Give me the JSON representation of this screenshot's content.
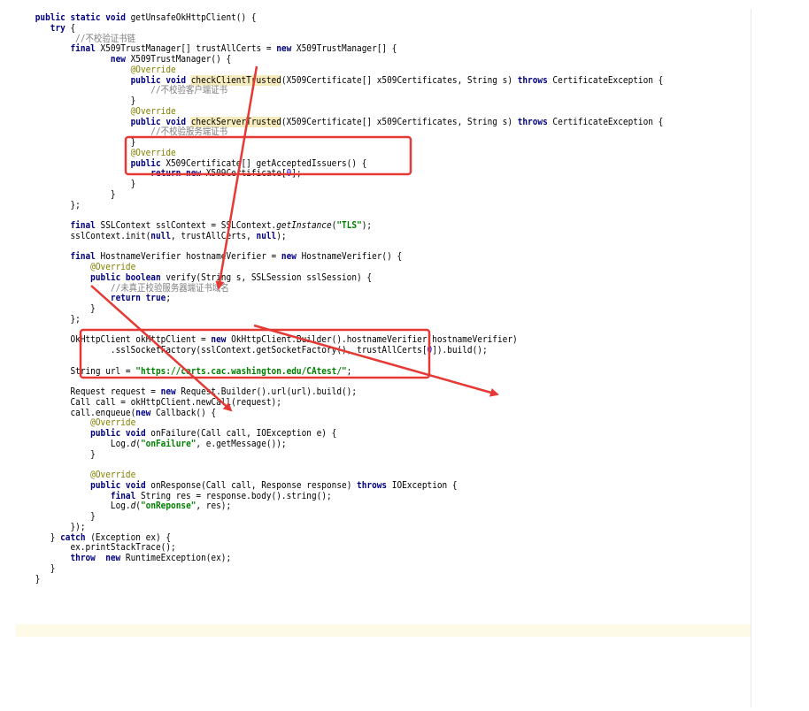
{
  "colors": {
    "keyword": "#000080",
    "annotation": "#808000",
    "comment": "#808080",
    "string": "#008000",
    "number": "#0000ff",
    "usage_highlight": "#f6ebbc",
    "current_line": "#fefae8",
    "markup_red": "#e53935"
  },
  "code_lines": [
    {
      "indent": 1,
      "tokens": [
        {
          "t": "public static void ",
          "c": "kw"
        },
        {
          "t": "getUnsafeOkHttpClient() {"
        }
      ]
    },
    {
      "indent": 4,
      "tokens": [
        {
          "t": "try ",
          "c": "kw"
        },
        {
          "t": "{"
        }
      ]
    },
    {
      "indent": 9,
      "tokens": [
        {
          "t": "//不校验证书链",
          "c": "com"
        }
      ]
    },
    {
      "indent": 8,
      "tokens": [
        {
          "t": "final ",
          "c": "kw"
        },
        {
          "t": "X509TrustManager[] trustAllCerts = "
        },
        {
          "t": "new ",
          "c": "kw"
        },
        {
          "t": "X509TrustManager[] {"
        }
      ]
    },
    {
      "indent": 16,
      "tokens": [
        {
          "t": "new ",
          "c": "kw"
        },
        {
          "t": "X509TrustManager() {"
        }
      ]
    },
    {
      "indent": 20,
      "tokens": [
        {
          "t": "@Override",
          "c": "ann"
        }
      ]
    },
    {
      "indent": 20,
      "tokens": [
        {
          "t": "public void ",
          "c": "kw"
        },
        {
          "t": "checkClientTrusted",
          "c": "usage"
        },
        {
          "t": "(X509Certificate[] x509Certificates, String s) "
        },
        {
          "t": "throws ",
          "c": "kw"
        },
        {
          "t": "CertificateException {"
        }
      ]
    },
    {
      "indent": 24,
      "tokens": [
        {
          "t": "//不校验客户端证书",
          "c": "com"
        }
      ]
    },
    {
      "indent": 20,
      "tokens": [
        {
          "t": "}"
        }
      ]
    },
    {
      "indent": 20,
      "tokens": [
        {
          "t": "@Override",
          "c": "ann"
        }
      ]
    },
    {
      "indent": 20,
      "tokens": [
        {
          "t": "public void ",
          "c": "kw"
        },
        {
          "t": "checkServerTrusted",
          "c": "usage"
        },
        {
          "t": "(X509Certificate[] x509Certificates, String s) "
        },
        {
          "t": "throws ",
          "c": "kw"
        },
        {
          "t": "CertificateException {"
        }
      ]
    },
    {
      "indent": 24,
      "tokens": [
        {
          "t": "//不校验服务端证书",
          "c": "com"
        }
      ]
    },
    {
      "indent": 20,
      "tokens": [
        {
          "t": "}"
        }
      ]
    },
    {
      "indent": 20,
      "tokens": [
        {
          "t": "@Override",
          "c": "ann"
        }
      ]
    },
    {
      "indent": 20,
      "tokens": [
        {
          "t": "public ",
          "c": "kw"
        },
        {
          "t": "X509Certificate[] getAcceptedIssuers() {"
        }
      ]
    },
    {
      "indent": 24,
      "tokens": [
        {
          "t": "return new ",
          "c": "kw"
        },
        {
          "t": "X509Certificate["
        },
        {
          "t": "0",
          "c": "num"
        },
        {
          "t": "];"
        }
      ]
    },
    {
      "indent": 20,
      "tokens": [
        {
          "t": "}"
        }
      ]
    },
    {
      "indent": 16,
      "tokens": [
        {
          "t": "}"
        }
      ]
    },
    {
      "indent": 8,
      "tokens": [
        {
          "t": "};"
        }
      ]
    },
    {
      "indent": 0,
      "tokens": []
    },
    {
      "indent": 8,
      "tokens": [
        {
          "t": "final ",
          "c": "kw"
        },
        {
          "t": "SSLContext sslContext = SSLContext."
        },
        {
          "t": "getInstance",
          "c": "ital"
        },
        {
          "t": "("
        },
        {
          "t": "\"TLS\"",
          "c": "str"
        },
        {
          "t": ");"
        }
      ]
    },
    {
      "indent": 8,
      "tokens": [
        {
          "t": "sslContext.init("
        },
        {
          "t": "null",
          "c": "kw"
        },
        {
          "t": ", trustAllCerts, "
        },
        {
          "t": "null",
          "c": "kw"
        },
        {
          "t": ");"
        }
      ]
    },
    {
      "indent": 0,
      "tokens": []
    },
    {
      "indent": 8,
      "tokens": [
        {
          "t": "final ",
          "c": "kw"
        },
        {
          "t": "HostnameVerifier hostnameVerifier = "
        },
        {
          "t": "new ",
          "c": "kw"
        },
        {
          "t": "HostnameVerifier() {"
        }
      ]
    },
    {
      "indent": 12,
      "tokens": [
        {
          "t": "@Override",
          "c": "ann"
        }
      ]
    },
    {
      "indent": 12,
      "tokens": [
        {
          "t": "public boolean ",
          "c": "kw"
        },
        {
          "t": "verify(String s, SSLSession sslSession) {"
        }
      ]
    },
    {
      "indent": 16,
      "tokens": [
        {
          "t": "//未真正校验服务器端证书域名",
          "c": "com"
        }
      ]
    },
    {
      "indent": 16,
      "tokens": [
        {
          "t": "return true",
          "c": "kw"
        },
        {
          "t": ";"
        }
      ]
    },
    {
      "indent": 12,
      "tokens": [
        {
          "t": "}"
        }
      ]
    },
    {
      "indent": 8,
      "tokens": [
        {
          "t": "};"
        }
      ]
    },
    {
      "indent": 0,
      "tokens": []
    },
    {
      "indent": 8,
      "tokens": [
        {
          "t": "OkHttpClient okHttpClient = "
        },
        {
          "t": "new ",
          "c": "kw"
        },
        {
          "t": "OkHttpClient.Builder().hostnameVerifier(hostnameVerifier)"
        }
      ]
    },
    {
      "indent": 16,
      "tokens": [
        {
          "t": ".sslSocketFactory(sslContext.getSocketFactory(), trustAllCerts["
        },
        {
          "t": "0",
          "c": "num"
        },
        {
          "t": "]).build();"
        }
      ]
    },
    {
      "indent": 0,
      "tokens": []
    },
    {
      "indent": 8,
      "tokens": [
        {
          "t": "String url = "
        },
        {
          "t": "\"https://certs.cac.washington.edu/CAtest/\"",
          "c": "str"
        },
        {
          "t": ";"
        }
      ]
    },
    {
      "indent": 0,
      "tokens": []
    },
    {
      "indent": 8,
      "tokens": [
        {
          "t": "Request request = "
        },
        {
          "t": "new ",
          "c": "kw"
        },
        {
          "t": "Request.Builder().url(url).build();"
        }
      ]
    },
    {
      "indent": 8,
      "tokens": [
        {
          "t": "Call call = okHttpClient.newCall(request);"
        }
      ]
    },
    {
      "indent": 8,
      "tokens": [
        {
          "t": "call.enqueue("
        },
        {
          "t": "new ",
          "c": "kw"
        },
        {
          "t": "Callback() {"
        }
      ]
    },
    {
      "indent": 12,
      "tokens": [
        {
          "t": "@Override",
          "c": "ann"
        }
      ]
    },
    {
      "indent": 12,
      "tokens": [
        {
          "t": "public void ",
          "c": "kw"
        },
        {
          "t": "onFailure(Call call, IOException e) {"
        }
      ]
    },
    {
      "indent": 16,
      "tokens": [
        {
          "t": "Log."
        },
        {
          "t": "d",
          "c": "ital"
        },
        {
          "t": "("
        },
        {
          "t": "\"onFailure\"",
          "c": "str"
        },
        {
          "t": ", e.getMessage());"
        }
      ]
    },
    {
      "indent": 12,
      "tokens": [
        {
          "t": "}"
        }
      ]
    },
    {
      "indent": 0,
      "tokens": []
    },
    {
      "indent": 12,
      "tokens": [
        {
          "t": "@Override",
          "c": "ann"
        }
      ]
    },
    {
      "indent": 12,
      "tokens": [
        {
          "t": "public void ",
          "c": "kw"
        },
        {
          "t": "onResponse(Call call, Response response) "
        },
        {
          "t": "throws ",
          "c": "kw"
        },
        {
          "t": "IOException {"
        }
      ]
    },
    {
      "indent": 16,
      "tokens": [
        {
          "t": "final ",
          "c": "kw"
        },
        {
          "t": "String res = response.body().string();"
        }
      ]
    },
    {
      "indent": 16,
      "tokens": [
        {
          "t": "Log."
        },
        {
          "t": "d",
          "c": "ital"
        },
        {
          "t": "("
        },
        {
          "t": "\"onReponse\"",
          "c": "str"
        },
        {
          "t": ", res);"
        }
      ]
    },
    {
      "indent": 12,
      "tokens": [
        {
          "t": "}"
        }
      ]
    },
    {
      "indent": 8,
      "tokens": [
        {
          "t": "});"
        }
      ]
    },
    {
      "indent": 4,
      "tokens": [
        {
          "t": "} "
        },
        {
          "t": "catch ",
          "c": "kw"
        },
        {
          "t": "(Exception ex) {"
        }
      ]
    },
    {
      "indent": 8,
      "tokens": [
        {
          "t": "ex.printStackTrace();"
        }
      ]
    },
    {
      "indent": 8,
      "tokens": [
        {
          "t": "throw  new ",
          "c": "kw"
        },
        {
          "t": "RuntimeException(ex);"
        }
      ]
    },
    {
      "indent": 4,
      "tokens": [
        {
          "t": "}"
        }
      ]
    },
    {
      "indent": 1,
      "tokens": [
        {
          "t": "}"
        }
      ]
    }
  ]
}
